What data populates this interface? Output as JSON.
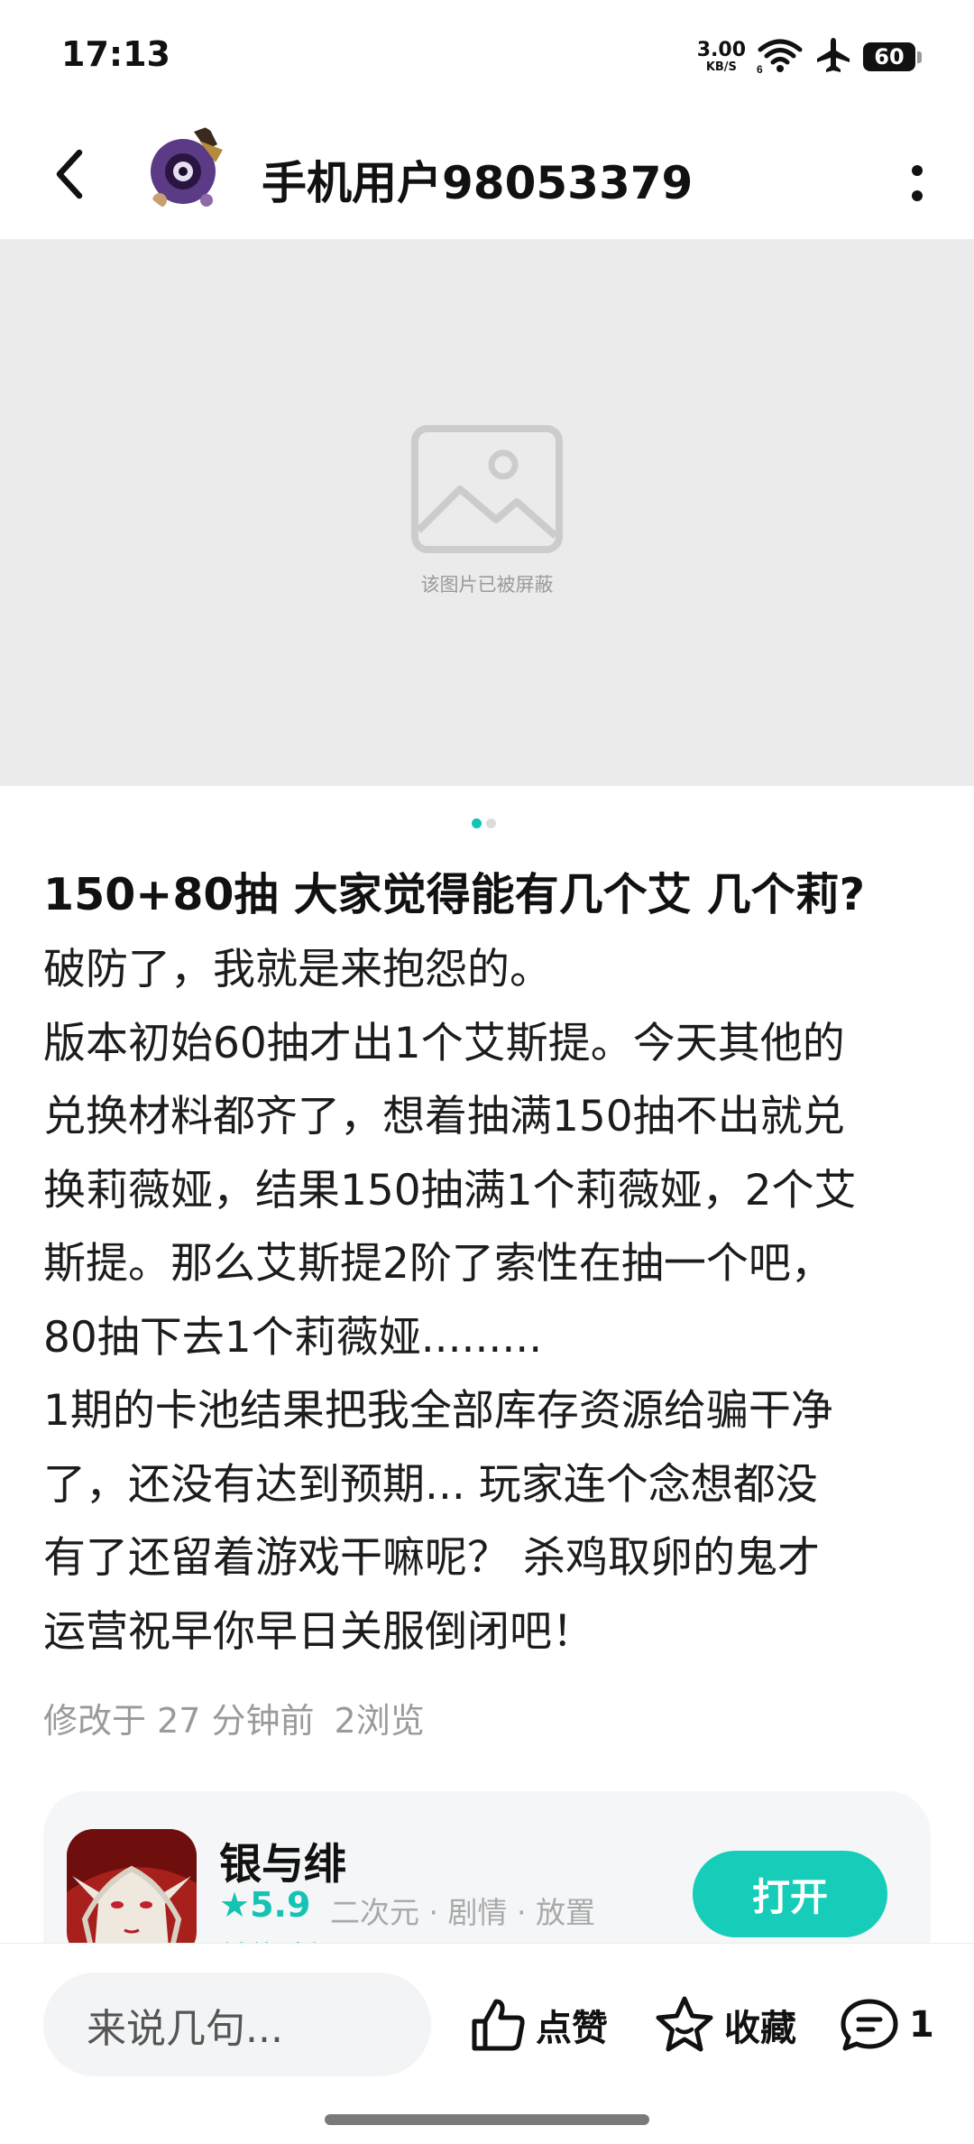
{
  "status_bar": {
    "time": "17:13",
    "net_speed_value": "3.00",
    "net_speed_unit": "KB/S",
    "battery": "60",
    "icons": [
      "wifi-icon",
      "airplane-icon",
      "battery-icon"
    ]
  },
  "header": {
    "username": "手机用户98053379",
    "icons": [
      "back-arrow-icon",
      "more-vertical-icon"
    ]
  },
  "media": {
    "blocked_text": "该图片已被屏蔽",
    "page_count": 2,
    "active_page": 1
  },
  "post": {
    "title": "150+80抽 大家觉得能有几个艾 几个莉?",
    "body_lines": [
      "破防了，我就是来抱怨的。",
      "版本初始60抽才出1个艾斯提。今天其他的",
      "兑换材料都齐了，想着抽满150抽不出就兑",
      "换莉薇娅，结果150抽满1个莉薇娅，2个艾",
      "斯提。那么艾斯提2阶了索性在抽一个吧，",
      "80抽下去1个莉薇娅.........",
      "1期的卡池结果把我全部库存资源给骗干净",
      "了，还没有达到预期... 玩家连个念想都没",
      "有了还留着游戏干嘛呢？ 杀鸡取卵的鬼才",
      "运营祝早你早日关服倒闭吧！"
    ],
    "modified": "修改于 27 分钟前",
    "views": "2浏览"
  },
  "game_card": {
    "name": "银与绯",
    "rating": "★5.9",
    "tags": "二次元 · 剧情 · 放置",
    "forum_link": "前往论坛 >",
    "open_label": "打开"
  },
  "bottom_bar": {
    "comment_placeholder": "来说几句...",
    "like_label": "点赞",
    "favorite_label": "收藏",
    "comment_count": "1"
  },
  "colors": {
    "accent": "#15cdb9",
    "image_placeholder_bg": "#ebebeb",
    "muted_text": "#9a9a9a"
  }
}
